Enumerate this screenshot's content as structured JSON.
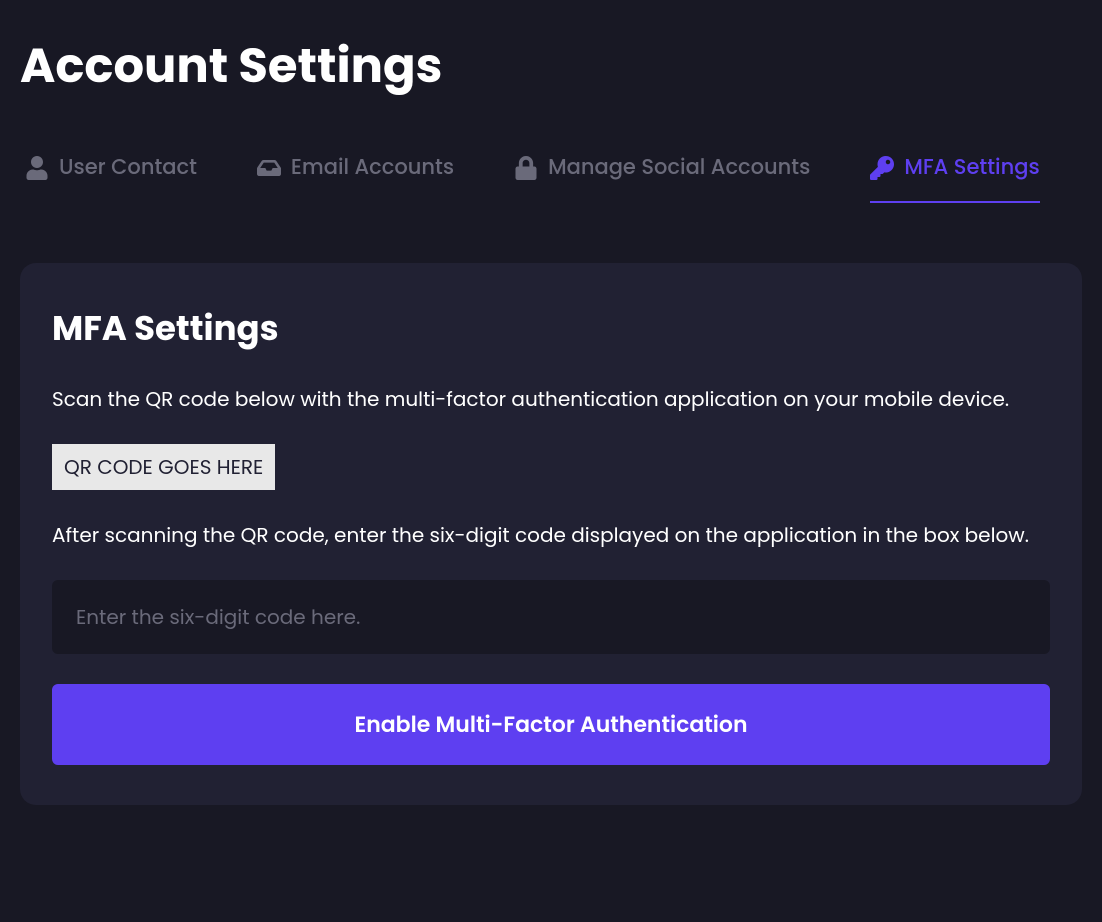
{
  "page": {
    "title": "Account Settings"
  },
  "tabs": {
    "user_contact": {
      "label": "User Contact",
      "active": false
    },
    "email_accounts": {
      "label": "Email Accounts",
      "active": false
    },
    "manage_social": {
      "label": "Manage Social Accounts",
      "active": false
    },
    "mfa_settings": {
      "label": "MFA Settings",
      "active": true
    }
  },
  "card": {
    "title": "MFA Settings",
    "instruction1": "Scan the QR code below with the multi-factor authentication application on your mobile device.",
    "qr_placeholder": "QR CODE GOES HERE",
    "instruction2": "After scanning the QR code, enter the six-digit code displayed on the application in the box below.",
    "input_placeholder": "Enter the six-digit code here.",
    "button_label": "Enable Multi-Factor Authentication"
  },
  "colors": {
    "background": "#181824",
    "card_bg": "#212133",
    "accent": "#5e3ff1",
    "muted": "#6a6a7a"
  }
}
